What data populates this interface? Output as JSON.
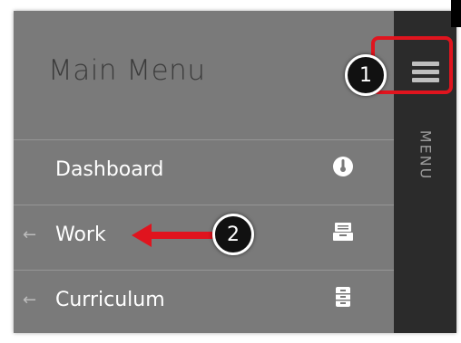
{
  "menu": {
    "title": "Main Menu",
    "items": [
      {
        "label": "Dashboard",
        "has_arrow": false,
        "arrow": "",
        "icon": "dashboard-gauge-icon"
      },
      {
        "label": "Work",
        "has_arrow": true,
        "arrow": "←",
        "icon": "inbox-tray-icon"
      },
      {
        "label": "Curriculum",
        "has_arrow": true,
        "arrow": "←",
        "icon": "file-cabinet-icon"
      }
    ]
  },
  "sidebar": {
    "label": "MENU",
    "toggle_icon": "hamburger-icon"
  },
  "annotations": {
    "step1": "1",
    "step2": "2",
    "highlight_color": "#e0141e"
  },
  "colors": {
    "panel_bg": "#7a7a7a",
    "sidebar_bg": "#2b2b2b",
    "text": "#ffffff",
    "title": "#3b3b3b"
  }
}
